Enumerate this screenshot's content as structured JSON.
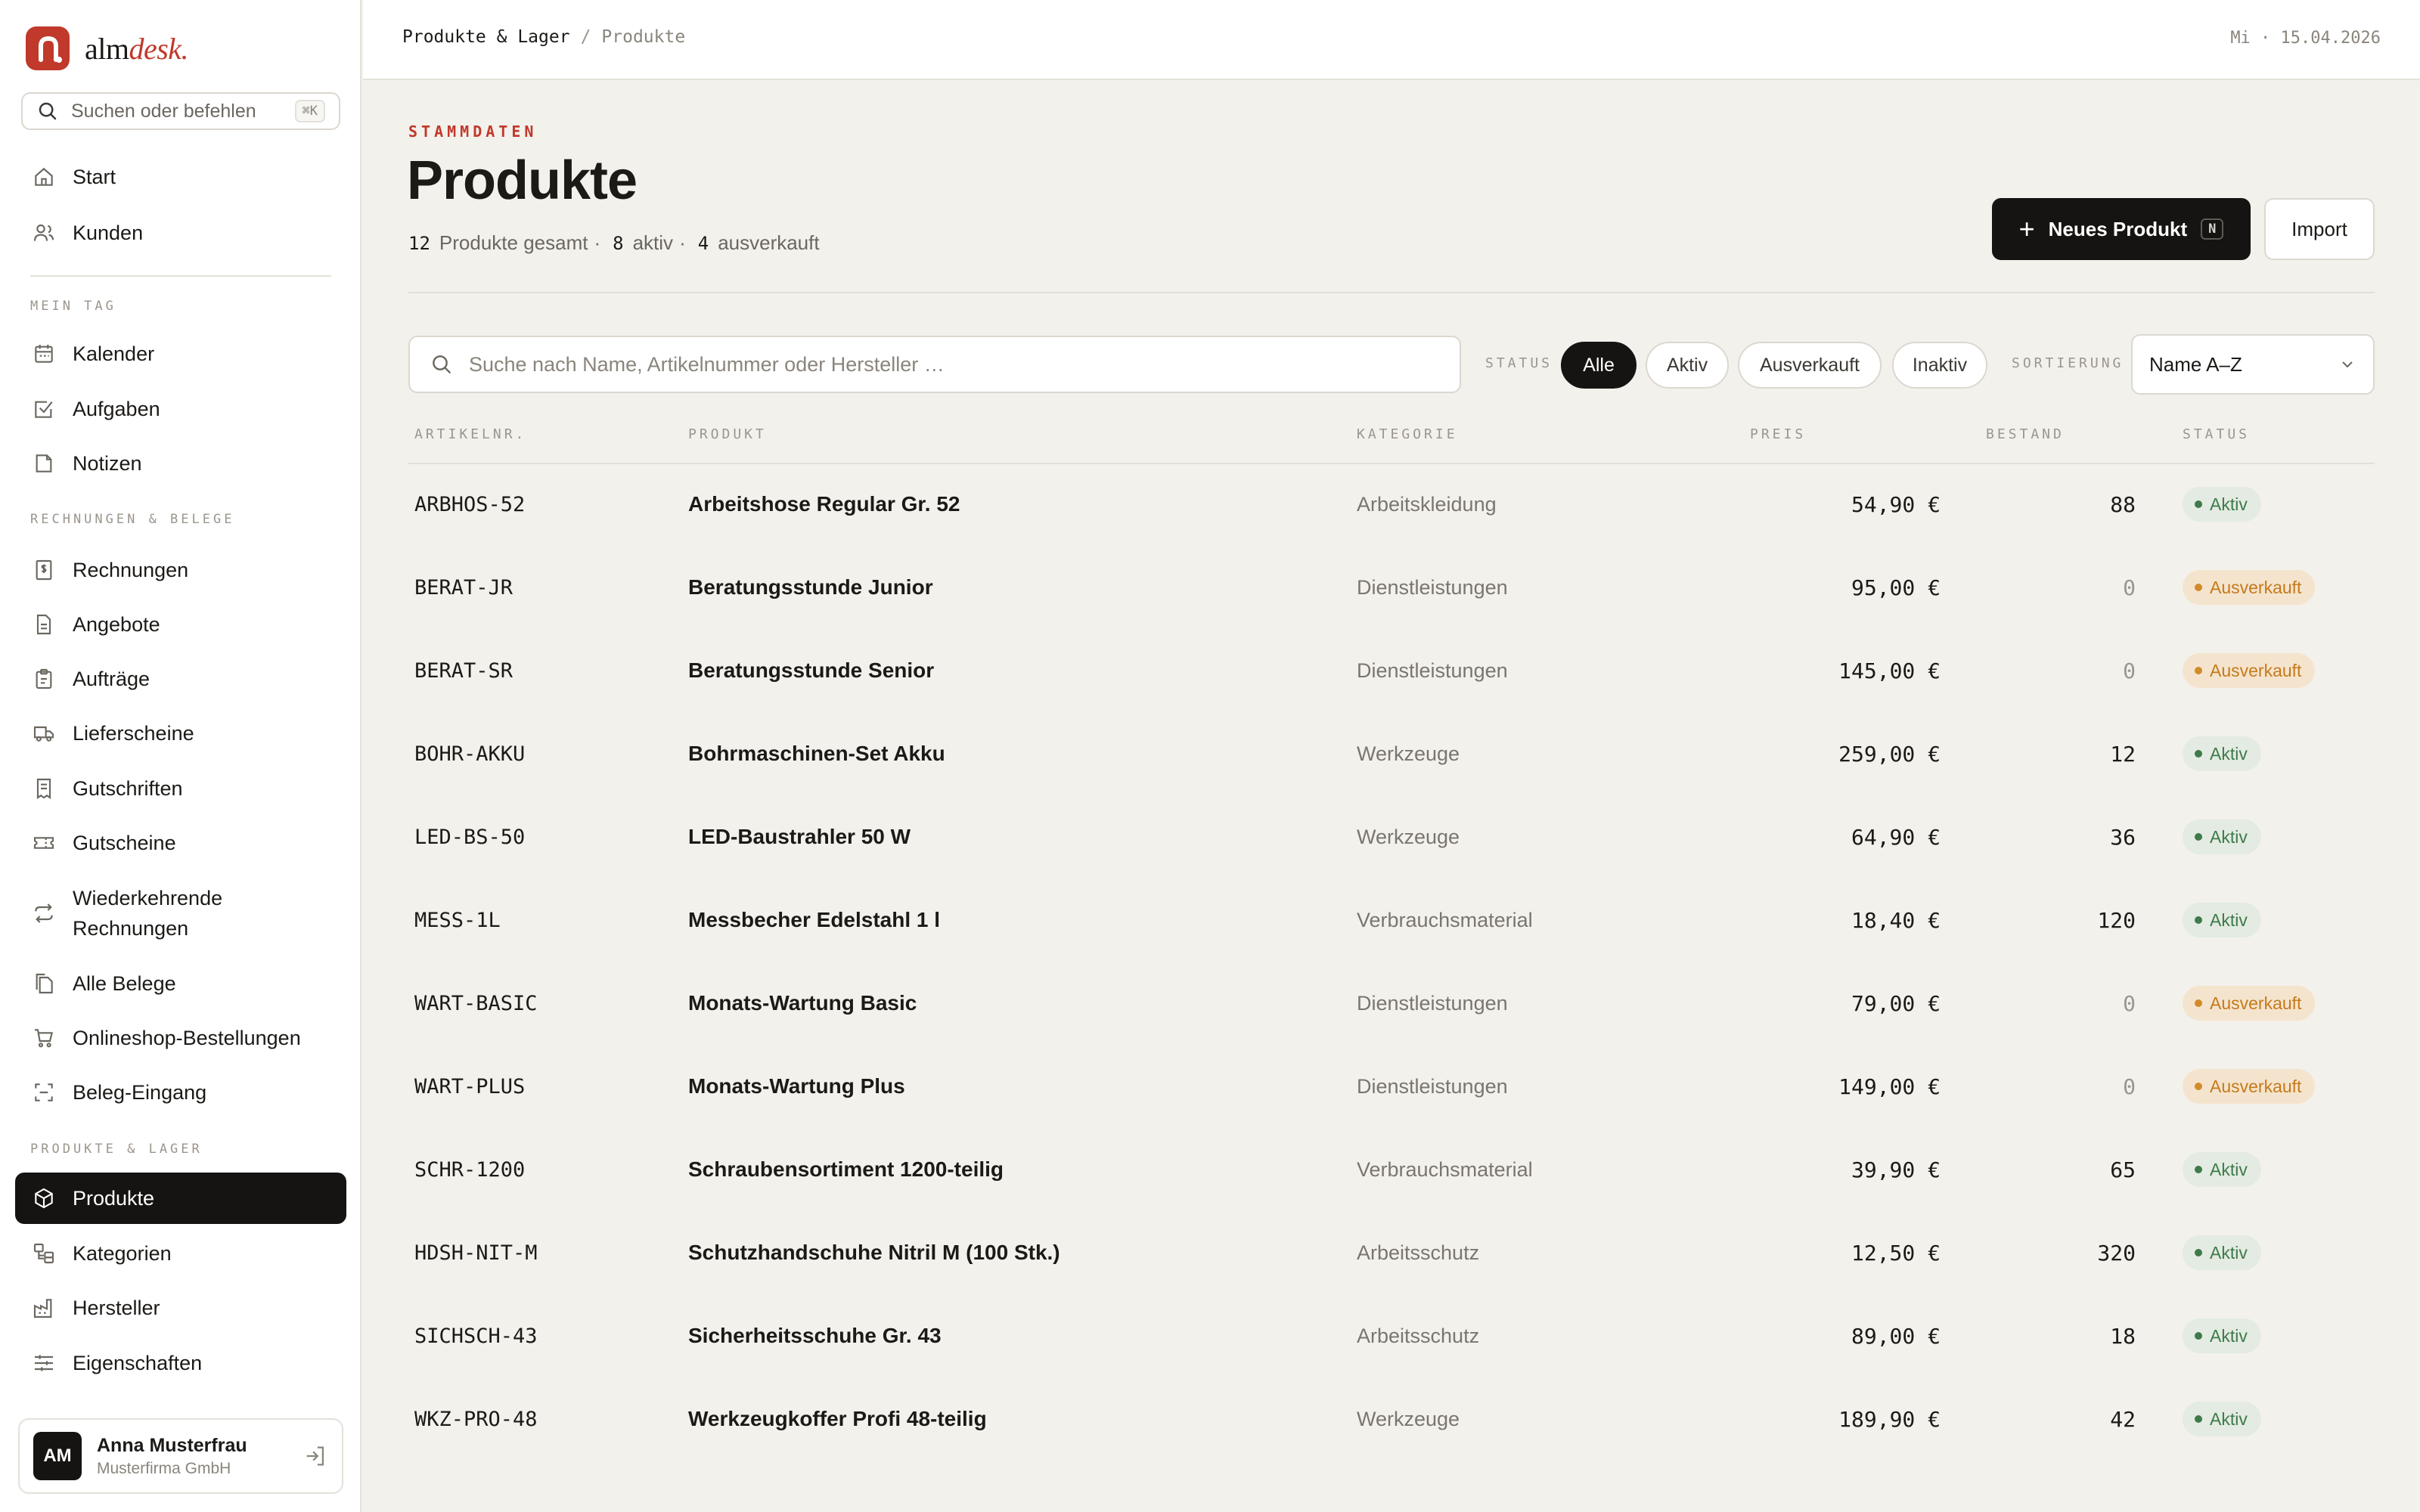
{
  "brand": {
    "name_part1": "alm",
    "name_part2": "desk."
  },
  "sidebar": {
    "search_label": "Suchen oder befehlen",
    "search_shortcut": "⌘K",
    "items_top": [
      {
        "label": "Start",
        "icon": "home-icon"
      },
      {
        "label": "Kunden",
        "icon": "users-icon"
      }
    ],
    "section_day": "MEIN TAG",
    "items_day": [
      {
        "label": "Kalender",
        "icon": "calendar-icon"
      },
      {
        "label": "Aufgaben",
        "icon": "checkbox-icon"
      },
      {
        "label": "Notizen",
        "icon": "note-icon"
      }
    ],
    "section_docs": "RECHNUNGEN & BELEGE",
    "items_docs": [
      {
        "label": "Rechnungen",
        "icon": "invoice-icon"
      },
      {
        "label": "Angebote",
        "icon": "document-icon"
      },
      {
        "label": "Aufträge",
        "icon": "clipboard-icon"
      },
      {
        "label": "Lieferscheine",
        "icon": "truck-icon"
      },
      {
        "label": "Gutschriften",
        "icon": "receipt-icon"
      },
      {
        "label": "Gutscheine",
        "icon": "ticket-icon"
      },
      {
        "label": "Wiederkehrende Rechnungen",
        "icon": "repeat-icon"
      },
      {
        "label": "Alle Belege",
        "icon": "files-icon"
      },
      {
        "label": "Onlineshop-Bestellungen",
        "icon": "cart-icon"
      },
      {
        "label": "Beleg-Eingang",
        "icon": "scan-icon"
      }
    ],
    "section_products": "PRODUKTE & LAGER",
    "items_products": [
      {
        "label": "Produkte",
        "icon": "box-icon",
        "active": true
      },
      {
        "label": "Kategorien",
        "icon": "category-icon"
      },
      {
        "label": "Hersteller",
        "icon": "factory-icon"
      },
      {
        "label": "Eigenschaften",
        "icon": "sliders-icon"
      }
    ],
    "user": {
      "initials": "AM",
      "name": "Anna Musterfrau",
      "company": "Musterfirma GmbH"
    }
  },
  "topbar": {
    "breadcrumb_parent": "Produkte & Lager",
    "breadcrumb_sep": "/",
    "breadcrumb_current": "Produkte",
    "date": "Mi · 15.04.2026"
  },
  "header": {
    "eyebrow": "STAMMDATEN",
    "title": "Produkte",
    "total_count": "12",
    "total_label": "Produkte gesamt",
    "active_count": "8",
    "active_label": "aktiv",
    "soldout_count": "4",
    "soldout_label": "ausverkauft",
    "new_button": "Neues Produkt",
    "new_shortcut": "N",
    "import_button": "Import"
  },
  "filters": {
    "search_placeholder": "Suche nach Name, Artikelnummer oder Hersteller …",
    "status_label": "STATUS",
    "chips": [
      "Alle",
      "Aktiv",
      "Ausverkauft",
      "Inaktiv"
    ],
    "active_chip": "Alle",
    "sort_label": "SORTIERUNG",
    "sort_value": "Name A–Z"
  },
  "table": {
    "columns": [
      "ARTIKELNR.",
      "PRODUKT",
      "KATEGORIE",
      "PREIS",
      "BESTAND",
      "STATUS"
    ],
    "rows": [
      {
        "sku": "ARBHOS-52",
        "name": "Arbeitshose Regular Gr. 52",
        "category": "Arbeitskleidung",
        "price": "54,90 €",
        "stock": "88",
        "status": "Aktiv"
      },
      {
        "sku": "BERAT-JR",
        "name": "Beratungsstunde Junior",
        "category": "Dienstleistungen",
        "price": "95,00 €",
        "stock": "0",
        "status": "Ausverkauft"
      },
      {
        "sku": "BERAT-SR",
        "name": "Beratungsstunde Senior",
        "category": "Dienstleistungen",
        "price": "145,00 €",
        "stock": "0",
        "status": "Ausverkauft"
      },
      {
        "sku": "BOHR-AKKU",
        "name": "Bohrmaschinen-Set Akku",
        "category": "Werkzeuge",
        "price": "259,00 €",
        "stock": "12",
        "status": "Aktiv"
      },
      {
        "sku": "LED-BS-50",
        "name": "LED-Baustrahler 50 W",
        "category": "Werkzeuge",
        "price": "64,90 €",
        "stock": "36",
        "status": "Aktiv"
      },
      {
        "sku": "MESS-1L",
        "name": "Messbecher Edelstahl 1 l",
        "category": "Verbrauchsmaterial",
        "price": "18,40 €",
        "stock": "120",
        "status": "Aktiv"
      },
      {
        "sku": "WART-BASIC",
        "name": "Monats-Wartung Basic",
        "category": "Dienstleistungen",
        "price": "79,00 €",
        "stock": "0",
        "status": "Ausverkauft"
      },
      {
        "sku": "WART-PLUS",
        "name": "Monats-Wartung Plus",
        "category": "Dienstleistungen",
        "price": "149,00 €",
        "stock": "0",
        "status": "Ausverkauft"
      },
      {
        "sku": "SCHR-1200",
        "name": "Schraubensortiment 1200-teilig",
        "category": "Verbrauchsmaterial",
        "price": "39,90 €",
        "stock": "65",
        "status": "Aktiv"
      },
      {
        "sku": "HDSH-NIT-M",
        "name": "Schutzhandschuhe Nitril M (100 Stk.)",
        "category": "Arbeitsschutz",
        "price": "12,50 €",
        "stock": "320",
        "status": "Aktiv"
      },
      {
        "sku": "SICHSCH-43",
        "name": "Sicherheitsschuhe Gr. 43",
        "category": "Arbeitsschutz",
        "price": "89,00 €",
        "stock": "18",
        "status": "Aktiv"
      },
      {
        "sku": "WKZ-PRO-48",
        "name": "Werkzeugkoffer Profi 48-teilig",
        "category": "Werkzeuge",
        "price": "189,90 €",
        "stock": "42",
        "status": "Aktiv"
      }
    ]
  },
  "colors": {
    "accent": "#c0392b",
    "dark": "#161412",
    "background": "#f3f1ec",
    "status_active_bg": "#e3ebe2",
    "status_active_fg": "#3e7a4a",
    "status_soldout_bg": "#f5e4cd",
    "status_soldout_fg": "#c47a1c"
  }
}
